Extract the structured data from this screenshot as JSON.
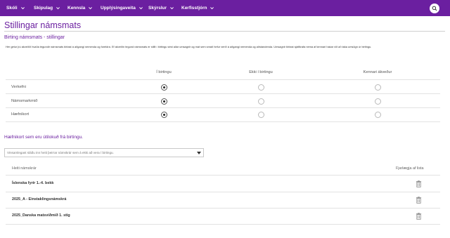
{
  "nav": {
    "items": [
      {
        "label": "Skóli"
      },
      {
        "label": "Skipulag"
      },
      {
        "label": "Kennsla"
      },
      {
        "label": "Upplýsingaveita"
      },
      {
        "label": "Skýrslur"
      },
      {
        "label": "Kerfisstjórn"
      }
    ],
    "search_icon": "search-icon",
    "brand_color": "#6b1fa0"
  },
  "page": {
    "title": "Stillingar námsmats"
  },
  "settings": {
    "section_title": "Birting námsmats - stillingar",
    "description": "Hér getur þú ákveðið hvaða tegundir námsmats birtast á aðgangi nemenda og foreldra. Ef ákveðin tegund námsmats er stillt í birtingu sést allar umsagnir og mat sem smáð hefur verið á aðgangi nemenda og aðstandenda. Umsagnir birtast sjálfkrafa nema af kennari hakar við að taka umsögn úr birtingu.",
    "columns": [
      "Í birtingu",
      "Ekki í birtingu",
      "Kennari ákveður"
    ],
    "rows": [
      {
        "label": "Verkefni",
        "selected": 0
      },
      {
        "label": "Námsmarkmið",
        "selected": 0
      },
      {
        "label": "Hæfnikort",
        "selected": 0
      }
    ]
  },
  "excluded": {
    "section_title": "Hæfnikort sem eru útilokuð frá birtingu.",
    "dropdown_placeholder": "Vinsamlegast sláðu inn heiti þeirrar námskrár sem á ekki að vera í birtingu.",
    "table_headers": {
      "name": "Heiti námskrár",
      "remove": "Fjarlægja af lista"
    },
    "rows": [
      {
        "name": "Íslenska fyrir 1.-4. bekk"
      },
      {
        "name": "2025_A - Einstaklingsnámskrá"
      },
      {
        "name": "2025_Danska matsviðmið 1. stig"
      }
    ],
    "remove_icon": "trash-icon"
  }
}
